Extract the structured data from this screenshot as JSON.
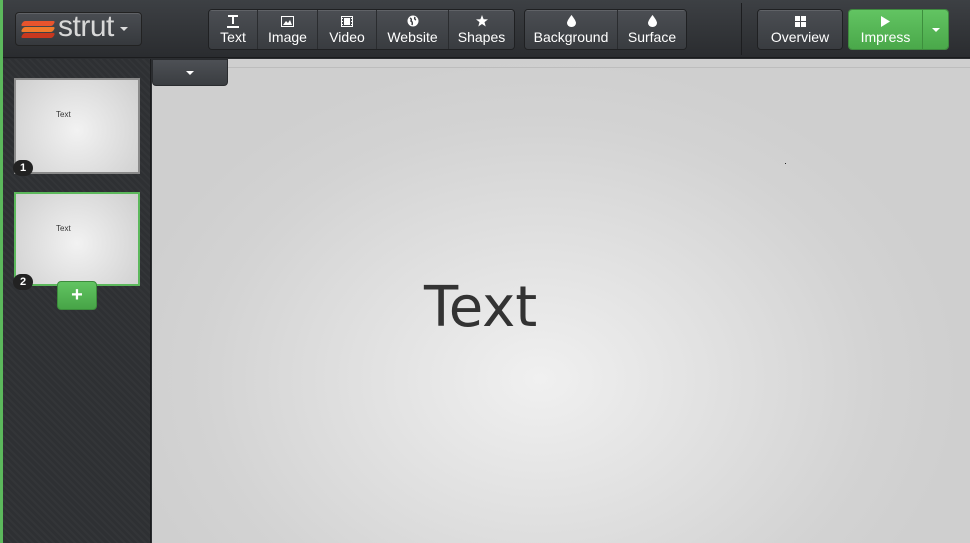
{
  "app": {
    "logo_text": "strut"
  },
  "toolbar": {
    "insert_buttons": [
      {
        "label": "Text",
        "icon": "text-icon"
      },
      {
        "label": "Image",
        "icon": "image-icon"
      },
      {
        "label": "Video",
        "icon": "video-icon"
      },
      {
        "label": "Website",
        "icon": "globe-icon"
      },
      {
        "label": "Shapes",
        "icon": "star-icon"
      }
    ],
    "style_buttons": [
      {
        "label": "Background",
        "icon": "droplet-icon"
      },
      {
        "label": "Surface",
        "icon": "droplet-icon"
      }
    ],
    "overview_label": "Overview",
    "impress_label": "Impress"
  },
  "slides": [
    {
      "number": "1",
      "preview_text": "Text",
      "active": false
    },
    {
      "number": "2",
      "preview_text": "Text",
      "active": true
    }
  ],
  "add_slide_label": "+",
  "canvas": {
    "text": "Text"
  },
  "colors": {
    "accent_green": "#5cb85c",
    "toolbar_bg": "#3d4044"
  }
}
